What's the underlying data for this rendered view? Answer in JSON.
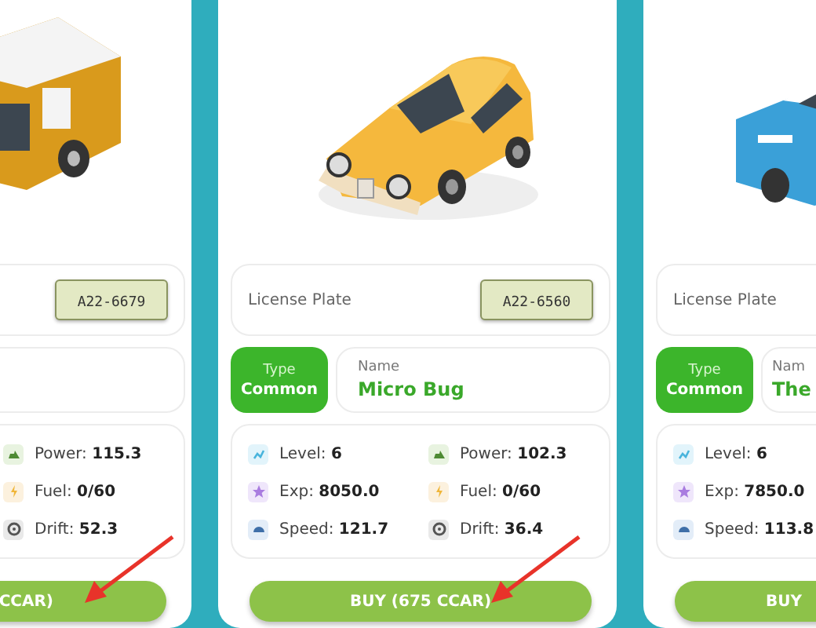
{
  "cards": [
    {
      "kind": "cut-left",
      "vehicle": {
        "kind": "van"
      },
      "plate": "A22-6679",
      "right_stats": [
        {
          "kind": "power",
          "label": "Power:",
          "value": "115.3"
        },
        {
          "kind": "fuel",
          "label": "Fuel:",
          "value": "0/60"
        },
        {
          "kind": "drift",
          "label": "Drift:",
          "value": "52.3"
        }
      ],
      "button": "CCAR)",
      "annotated": true
    },
    {
      "kind": "full",
      "vehicle": {
        "kind": "coupe"
      },
      "plate_label": "License Plate",
      "plate": "A22-6560",
      "type_label": "Type",
      "type": "Common",
      "name_label": "Name",
      "name": "Micro Bug",
      "left_stats": [
        {
          "kind": "level",
          "label": "Level:",
          "value": "6"
        },
        {
          "kind": "exp",
          "label": "Exp:",
          "value": "8050.0"
        },
        {
          "kind": "speed",
          "label": "Speed:",
          "value": "121.7"
        }
      ],
      "right_stats": [
        {
          "kind": "power",
          "label": "Power:",
          "value": "102.3"
        },
        {
          "kind": "fuel",
          "label": "Fuel:",
          "value": "0/60"
        },
        {
          "kind": "drift",
          "label": "Drift:",
          "value": "36.4"
        }
      ],
      "button": "BUY (675 CCAR)",
      "annotated": true
    },
    {
      "kind": "cut-right",
      "vehicle": {
        "kind": "police"
      },
      "plate_label": "License Plate",
      "type_label": "Type",
      "type": "Common",
      "name_label": "Nam",
      "name": "The",
      "left_stats": [
        {
          "kind": "level",
          "label": "Level:",
          "value": "6"
        },
        {
          "kind": "exp",
          "label": "Exp:",
          "value": "7850.0"
        },
        {
          "kind": "speed",
          "label": "Speed:",
          "value": "113.8"
        }
      ],
      "button": "BUY",
      "annotated": false
    }
  ]
}
